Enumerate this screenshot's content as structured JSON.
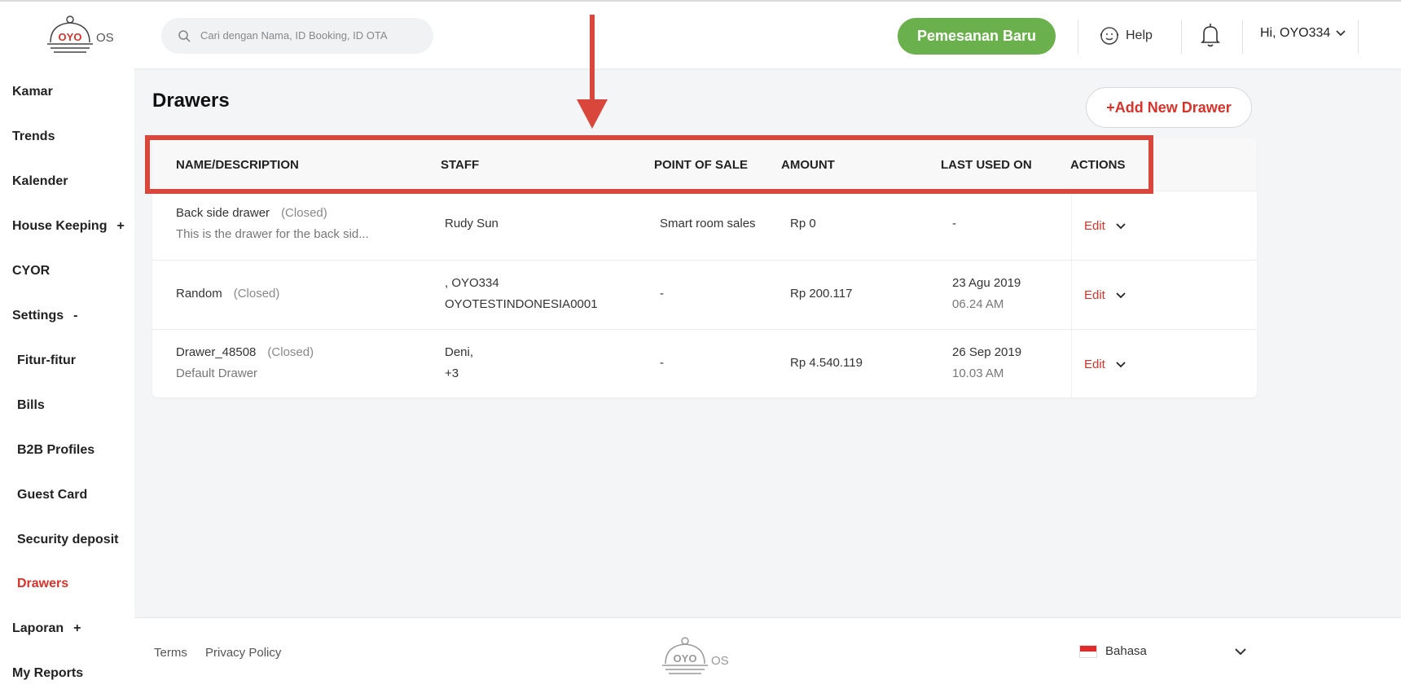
{
  "header": {
    "logo_text": "OYO",
    "logo_suffix": "OS",
    "search_placeholder": "Cari dengan Nama, ID Booking, ID OTA",
    "new_booking_label": "Pemesanan Baru",
    "help_label": "Help",
    "user_greeting": "Hi, OYO334"
  },
  "sidebar": {
    "items": [
      {
        "label": "Kamar",
        "mark": ""
      },
      {
        "label": "Trends",
        "mark": ""
      },
      {
        "label": "Kalender",
        "mark": ""
      },
      {
        "label": "House Keeping",
        "mark": "+"
      },
      {
        "label": "CYOR",
        "mark": ""
      },
      {
        "label": "Settings",
        "mark": "-"
      },
      {
        "label": "Fitur-fitur",
        "mark": ""
      },
      {
        "label": "Bills",
        "mark": ""
      },
      {
        "label": "B2B Profiles",
        "mark": ""
      },
      {
        "label": "Guest Card",
        "mark": ""
      },
      {
        "label": "Security deposit",
        "mark": ""
      },
      {
        "label": "Drawers",
        "mark": ""
      },
      {
        "label": "Laporan",
        "mark": "+"
      },
      {
        "label": "My Reports",
        "mark": ""
      }
    ]
  },
  "main": {
    "title": "Drawers",
    "add_button_label": "+Add New Drawer",
    "columns": [
      "NAME/DESCRIPTION",
      "STAFF",
      "POINT OF SALE",
      "AMOUNT",
      "LAST USED ON",
      "ACTIONS"
    ],
    "rows": [
      {
        "name": "Back side drawer",
        "status": "(Closed)",
        "description": "This is the drawer for the back sid...",
        "staff_line1": "Rudy Sun",
        "staff_line2": "",
        "pos": "Smart room sales",
        "amount": "Rp 0",
        "date": "-",
        "time": "",
        "action": "Edit"
      },
      {
        "name": "Random",
        "status": "(Closed)",
        "description": "",
        "staff_line1": ", OYO334",
        "staff_line2": "OYOTESTINDONESIA0001",
        "pos": "-",
        "amount": "Rp 200.117",
        "date": "23 Agu 2019",
        "time": "06.24 AM",
        "action": "Edit"
      },
      {
        "name": "Drawer_48508",
        "status": "(Closed)",
        "description": "Default Drawer",
        "staff_line1": "Deni,",
        "staff_line2": "+3",
        "pos": "-",
        "amount": "Rp 4.540.119",
        "date": "26 Sep 2019",
        "time": "10.03 AM",
        "action": "Edit"
      }
    ]
  },
  "footer": {
    "terms_label": "Terms",
    "privacy_label": "Privacy Policy",
    "logo_text": "OYO",
    "logo_suffix": "OS",
    "language_label": "Bahasa"
  },
  "colors": {
    "brand_red": "#d8322a",
    "accent_green": "#6ab04c",
    "annotation_red": "#d9473c"
  },
  "icons": [
    "search-icon",
    "help-face-icon",
    "bell-icon",
    "chevron-down-icon",
    "flag-icon"
  ]
}
